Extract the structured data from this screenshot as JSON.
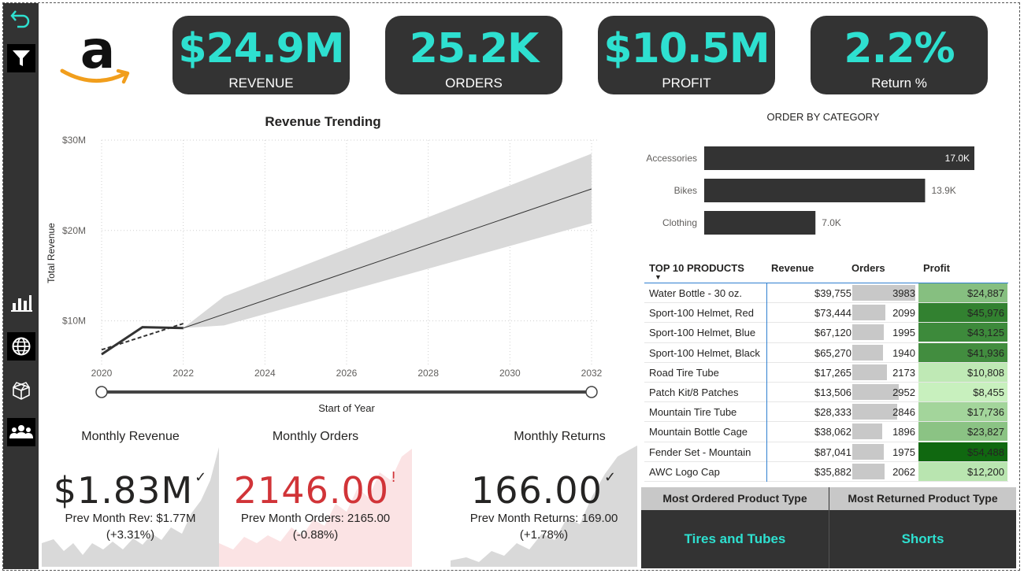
{
  "sidebar": {
    "items": [
      {
        "icon": "back-arrow-icon"
      },
      {
        "icon": "filter-icon"
      },
      {
        "icon": "bar-chart-icon"
      },
      {
        "icon": "globe-icon"
      },
      {
        "icon": "box-icon"
      },
      {
        "icon": "people-icon"
      }
    ]
  },
  "colors": {
    "accent": "#2ee0d0",
    "dark": "#333333",
    "negative": "#d13438",
    "band": "#d9d9d9"
  },
  "kpis": [
    {
      "value": "$24.9M",
      "label": "REVENUE"
    },
    {
      "value": "25.2K",
      "label": "ORDERS"
    },
    {
      "value": "$10.5M",
      "label": "PROFIT"
    },
    {
      "value": "2.2%",
      "label": "Return %"
    }
  ],
  "chart_data": [
    {
      "type": "line",
      "title": "Revenue Trending",
      "xlabel": "Start of Year",
      "ylabel": "Total Revenue",
      "x_ticks": [
        "2020",
        "2022",
        "2024",
        "2026",
        "2028",
        "2030",
        "2032"
      ],
      "y_ticks": [
        "$10M",
        "$20M",
        "$30M"
      ],
      "xlim": [
        2020,
        2032
      ],
      "ylim": [
        5,
        30
      ],
      "grid": true,
      "series": [
        {
          "x": [
            2020,
            2021,
            2022
          ],
          "y": [
            6.3,
            9.3,
            9.2
          ]
        },
        {
          "x": [
            2020,
            2022
          ],
          "y": [
            6.8,
            9.7
          ]
        }
      ],
      "forecast": {
        "x": [
          2022,
          2032
        ],
        "y": [
          9.2,
          24.6
        ],
        "upper": [
          9.2,
          28.5
        ],
        "lower": [
          9.2,
          20.8
        ],
        "band_start_upper": [
          2023,
          12.7
        ],
        "band_start_lower": [
          2023,
          9.5
        ]
      }
    },
    {
      "type": "bar",
      "title": "ORDER BY CATEGORY",
      "categories": [
        "Accessories",
        "Bikes",
        "Clothing"
      ],
      "values": [
        17.0,
        13.9,
        7.0
      ],
      "value_labels": [
        "17.0K",
        "13.9K",
        "7.0K"
      ],
      "orientation": "horizontal"
    }
  ],
  "products": {
    "headers": {
      "name": "TOP 10 PRODUCTS",
      "revenue": "Revenue",
      "orders": "Orders",
      "profit": "Profit"
    },
    "rows": [
      {
        "name": "Water Bottle - 30 oz.",
        "revenue": "$39,755",
        "orders": "3983",
        "profit": "$24,887",
        "orders_n": 3983,
        "profit_n": 24887
      },
      {
        "name": "Sport-100 Helmet, Red",
        "revenue": "$73,444",
        "orders": "2099",
        "profit": "$45,976",
        "orders_n": 2099,
        "profit_n": 45976
      },
      {
        "name": "Sport-100 Helmet, Blue",
        "revenue": "$67,120",
        "orders": "1995",
        "profit": "$43,125",
        "orders_n": 1995,
        "profit_n": 43125
      },
      {
        "name": "Sport-100 Helmet, Black",
        "revenue": "$65,270",
        "orders": "1940",
        "profit": "$41,936",
        "orders_n": 1940,
        "profit_n": 41936
      },
      {
        "name": "Road Tire Tube",
        "revenue": "$17,265",
        "orders": "2173",
        "profit": "$10,808",
        "orders_n": 2173,
        "profit_n": 10808
      },
      {
        "name": "Patch Kit/8 Patches",
        "revenue": "$13,506",
        "orders": "2952",
        "profit": "$8,455",
        "orders_n": 2952,
        "profit_n": 8455
      },
      {
        "name": "Mountain Tire Tube",
        "revenue": "$28,333",
        "orders": "2846",
        "profit": "$17,736",
        "orders_n": 2846,
        "profit_n": 17736
      },
      {
        "name": "Mountain Bottle Cage",
        "revenue": "$38,062",
        "orders": "1896",
        "profit": "$23,827",
        "orders_n": 1896,
        "profit_n": 23827
      },
      {
        "name": "Fender Set - Mountain",
        "revenue": "$87,041",
        "orders": "1975",
        "profit": "$54,488",
        "orders_n": 1975,
        "profit_n": 54488
      },
      {
        "name": "AWC Logo Cap",
        "revenue": "$35,882",
        "orders": "2062",
        "profit": "$12,200",
        "orders_n": 2062,
        "profit_n": 12200
      }
    ]
  },
  "product_types": {
    "most_ordered_label": "Most Ordered Product Type",
    "most_ordered_value": "Tires and Tubes",
    "most_returned_label": "Most Returned Product Type",
    "most_returned_value": "Shorts"
  },
  "cards": {
    "revenue": {
      "title": "Monthly Revenue",
      "value": "$1.83M",
      "mark": "✓",
      "prev": "Prev Month Rev: $1.77M",
      "pct": "(+3.31%)"
    },
    "orders": {
      "title": "Monthly Orders",
      "value": "2146.00",
      "mark": "!",
      "prev": "Prev Month Orders: 2165.00",
      "pct": "(-0.88%)"
    },
    "returns": {
      "title": "Monthly Returns",
      "value": "166.00",
      "mark": "✓",
      "prev": "Prev Month Returns: 169.00",
      "pct": "(+1.78%)"
    }
  }
}
